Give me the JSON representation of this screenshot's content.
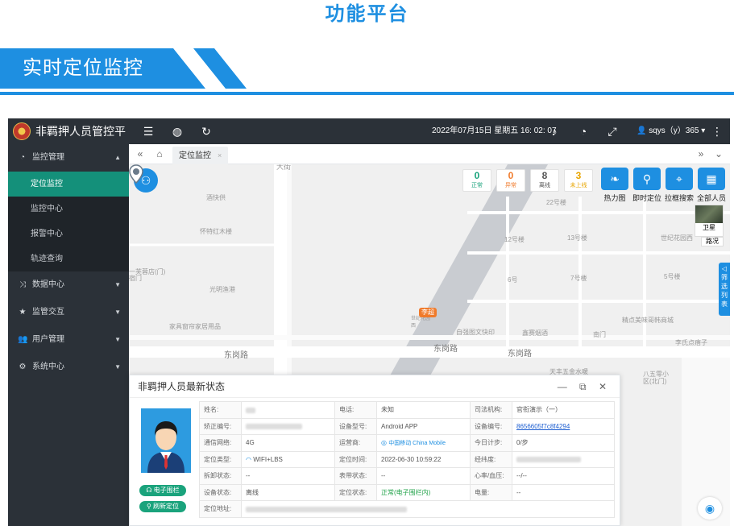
{
  "page_title": "功能平台",
  "section_title": "实时定位监控",
  "app": {
    "logo_text": "非羁押人员管控平",
    "datetime": "2022年07月15日 星期五 16: 02: 07",
    "user": "sqys（y）365"
  },
  "sidebar": {
    "menu1": {
      "label": "监控管理",
      "caret": "▲"
    },
    "submenu": [
      "定位监控",
      "监控中心",
      "报警中心",
      "轨迹查询"
    ],
    "menu2": "数据中心",
    "menu3": "监管交互",
    "menu4": "用户管理",
    "menu5": "系统中心",
    "caret_down": "▼"
  },
  "tabs": {
    "active": "定位监控",
    "close": "×"
  },
  "map": {
    "stats": [
      {
        "num": "0",
        "label": "正常",
        "color": "#1aa37c"
      },
      {
        "num": "0",
        "label": "异常",
        "color": "#f07a2a"
      },
      {
        "num": "8",
        "label": "离线",
        "color": "#555555"
      },
      {
        "num": "3",
        "label": "未上线",
        "color": "#e8a500"
      }
    ],
    "tools": [
      "热力图",
      "即时定位",
      "拉框搜索",
      "全部人员"
    ],
    "sat_label": "卫星",
    "road_label": "路况",
    "filter_label": "筛选列表",
    "marker_label": "李超",
    "labels": {
      "l1": "大街",
      "l2": "酒快供",
      "l3": "怀特红木楼",
      "l4": "光明渔港",
      "l5": "家具窗帘家居用品",
      "l6": "东岗路",
      "l7": "东岗路",
      "l8": "东岗路",
      "l9": "自强图文快印",
      "l10": "鑫赛烟酒",
      "l11": "世纪花园西",
      "l12": "精点美味哥韩商城",
      "l13": "李氏点痦子",
      "l14": "天丰五金水暖",
      "l15": "八五零小区(北门)",
      "l16": "22号楼",
      "l17": "12号楼",
      "l18": "13号楼",
      "l19": "7号楼",
      "l20": "6号",
      "l21": "5号楼",
      "l22": "南门",
      "l23": "世纪花园西",
      "l24": "一芙蓉店(门)",
      "l25": "宿门"
    }
  },
  "panel": {
    "title": "非羁押人员最新状态",
    "controls": "— ⧉ ✕",
    "btn_fence": "电子围栏",
    "btn_refresh": "刷新定位",
    "rows": [
      {
        "k1": "姓名:",
        "v1": "",
        "k2": "电话:",
        "v2": "未知",
        "k3": "司法机构:",
        "v3": "官衔演示（一）"
      },
      {
        "k1": "矫正编号:",
        "v1": "",
        "k2": "设备型号:",
        "v2": "Android APP",
        "k3": "设备编号:",
        "v3": "8656605f7c8f4294"
      },
      {
        "k1": "通信网络:",
        "v1": "4G",
        "k2": "运营商:",
        "v2": "中国移动 China Mobile",
        "k3": "今日计步:",
        "v3": "0/步"
      },
      {
        "k1": "定位类型:",
        "v1": "WIFI+LBS",
        "k2": "定位时间:",
        "v2": "2022-06-30 10:59:22",
        "k3": "经纬度:",
        "v3": ""
      },
      {
        "k1": "拆卸状态:",
        "v1": "--",
        "k2": "表带状态:",
        "v2": "--",
        "k3": "心率/血压:",
        "v3": "--/--"
      },
      {
        "k1": "设备状态:",
        "v1": "离线",
        "k2": "定位状态:",
        "v2": "正常(电子围栏内)",
        "k3": "电量:",
        "v3": "--"
      },
      {
        "k1": "定位地址:",
        "v1": ""
      }
    ]
  }
}
